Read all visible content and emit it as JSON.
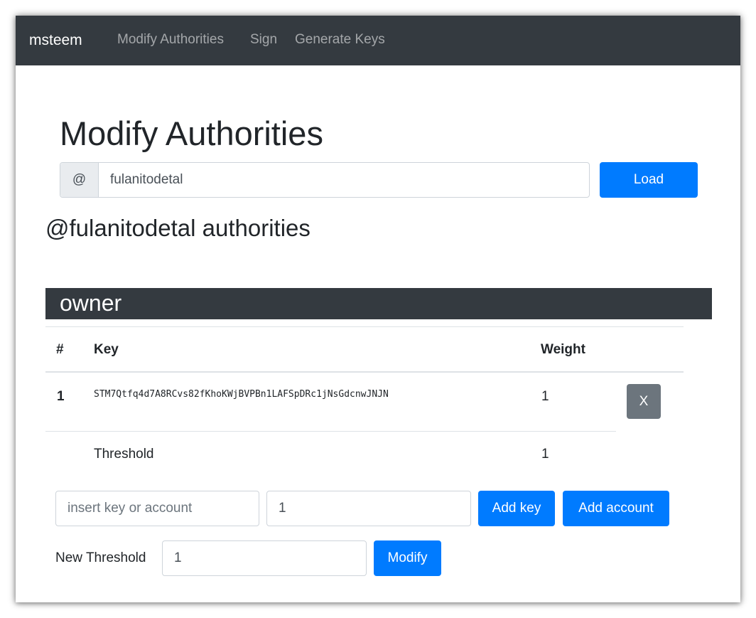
{
  "navbar": {
    "brand": "msteem",
    "links": [
      "Modify Authorities",
      "Sign",
      "Generate Keys"
    ]
  },
  "page": {
    "title": "Modify Authorities",
    "account_prefix": "@",
    "account_value": "fulanitodetal",
    "load_label": "Load",
    "subtitle": "@fulanitodetal authorities"
  },
  "owner": {
    "section_title": "owner",
    "headers": {
      "num": "#",
      "key": "Key",
      "weight": "Weight"
    },
    "rows": [
      {
        "num": "1",
        "key": "STM7Qtfq4d7A8RCvs82fKhoKWjBVPBn1LAFSpDRc1jNsGdcnwJNJN",
        "weight": "1",
        "remove_label": "X"
      }
    ],
    "threshold_label": "Threshold",
    "threshold_value": "1",
    "new_key_placeholder": "insert key or account",
    "new_weight_value": "1",
    "add_key_label": "Add key",
    "add_account_label": "Add account",
    "new_threshold_label": "New Threshold",
    "new_threshold_value": "1",
    "modify_label": "Modify"
  },
  "colors": {
    "navbar_bg": "#343a40",
    "primary": "#007bff",
    "secondary": "#6c757d"
  }
}
